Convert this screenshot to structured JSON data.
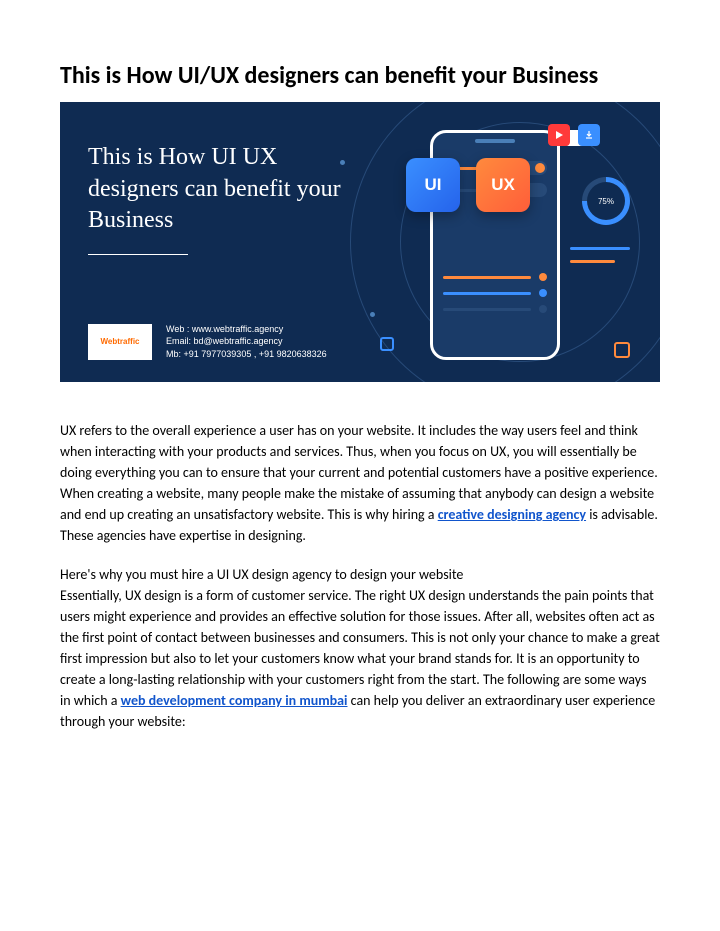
{
  "title": "This is How UI/UX designers can benefit your Business",
  "hero": {
    "title": "This is How UI UX designers can benefit your Business",
    "logo_text": "Webtraffic",
    "contact": {
      "web": "Web : www.webtraffic.agency",
      "email": "Email: bd@webtraffic.agency",
      "mb": "Mb: +91 7977039305 , +91 9820638326"
    },
    "card_ui": "UI",
    "card_ux": "UX",
    "progress": "75%"
  },
  "paragraphs": {
    "p1a": "UX refers to the overall experience a user has on your website. It includes the way users feel and think when interacting with your products and services. Thus, when you focus on UX, you will essentially be doing everything you can to ensure that your current and potential customers have a positive experience. When creating a website, many people make the mistake of assuming that anybody can design a website and end up creating an unsatisfactory website. This is why hiring a ",
    "link1": "creative designing agency",
    "p1b": " is advisable. These agencies have expertise in designing.",
    "p2a": "Here's why you must hire a UI UX design agency to design your website",
    "p2b": "Essentially, UX design is a form of customer service. The right UX design understands the pain points that users might experience and provides an effective solution for those issues. After all, websites often act as the first point of contact between businesses and consumers. This is not only your chance to make a great first impression but also to let your customers know what your brand stands for. It is an opportunity to create a long-lasting relationship with your customers right from the start. The following are some ways in which a ",
    "link2": "web development company in mumbai",
    "p2c": " can help you deliver an extraordinary user experience through your website:"
  }
}
